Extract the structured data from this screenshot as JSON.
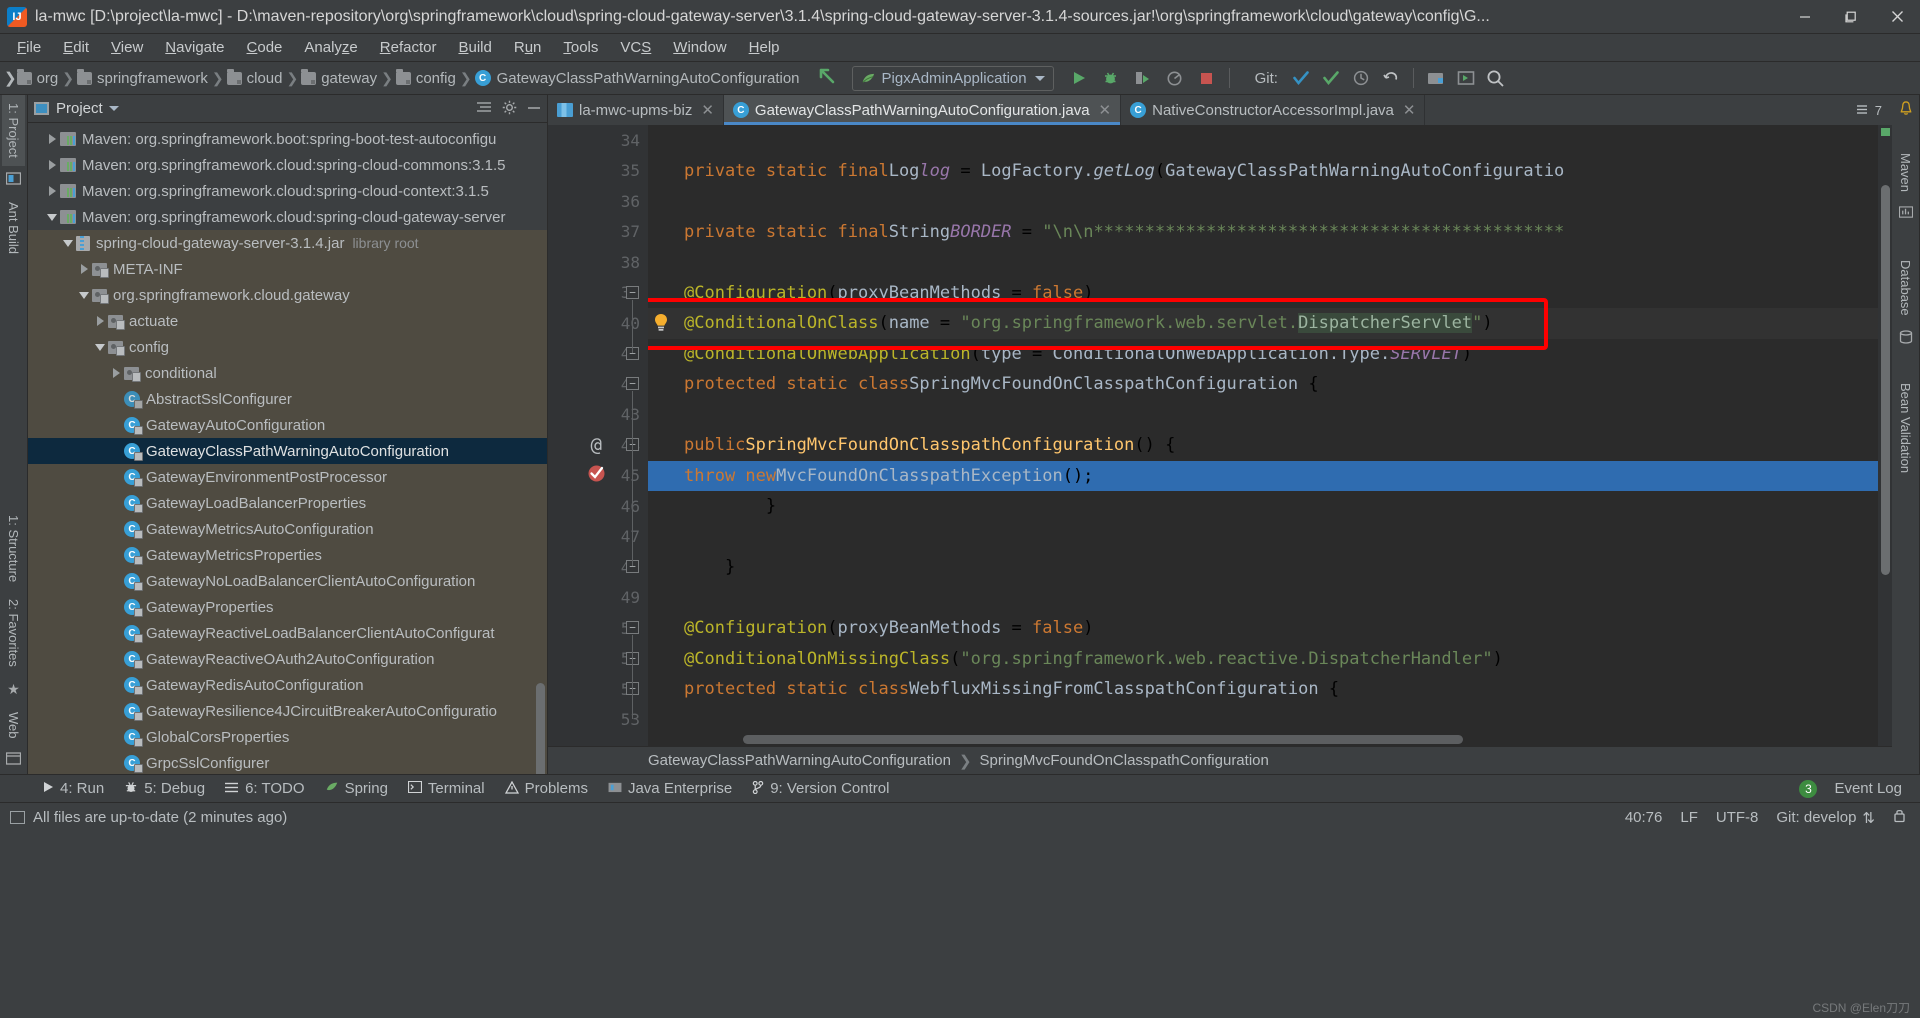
{
  "window": {
    "title": "la-mwc [D:\\project\\la-mwc] - D:\\maven-repository\\org\\springframework\\cloud\\spring-cloud-gateway-server\\3.1.4\\spring-cloud-gateway-server-3.1.4-sources.jar!\\org\\springframework\\cloud\\gateway\\config\\G...",
    "app_icon": "intellij-idea-icon",
    "minimize": "—",
    "maximize": "❐",
    "close": "✕"
  },
  "menubar": [
    {
      "label": "File"
    },
    {
      "label": "Edit"
    },
    {
      "label": "View"
    },
    {
      "label": "Navigate"
    },
    {
      "label": "Code"
    },
    {
      "label": "Analyze"
    },
    {
      "label": "Refactor"
    },
    {
      "label": "Build"
    },
    {
      "label": "Run"
    },
    {
      "label": "Tools"
    },
    {
      "label": "VCS"
    },
    {
      "label": "Window"
    },
    {
      "label": "Help"
    }
  ],
  "navbar": {
    "crumbs": [
      "org",
      "springframework",
      "cloud",
      "gateway",
      "config"
    ],
    "class_crumb": "GatewayClassPathWarningAutoConfiguration",
    "back_arrow_icon": "green-back-arrow-icon",
    "run_config": "PigxAdminApplication",
    "run_config_icon": "spring-leaf-icon",
    "buttons": [
      {
        "name": "run-button",
        "icon": "play-icon"
      },
      {
        "name": "debug-button",
        "icon": "bug-icon"
      },
      {
        "name": "run-with-coverage-button",
        "icon": "coverage-icon"
      },
      {
        "name": "profiler-button",
        "icon": "profiler-icon"
      },
      {
        "name": "stop-button",
        "icon": "stop-square-icon"
      }
    ],
    "git_label": "Git:",
    "git_buttons": [
      {
        "name": "git-update-project-button",
        "icon": "blue-checkmark-icon"
      },
      {
        "name": "git-commit-button",
        "icon": "green-checkmark-icon"
      },
      {
        "name": "git-history-button",
        "icon": "clock-icon"
      },
      {
        "name": "git-rollback-button",
        "icon": "undo-arrow-icon"
      }
    ],
    "right_buttons": [
      {
        "name": "project-structure-button",
        "icon": "project-structure-icon"
      },
      {
        "name": "select-run-target-button",
        "icon": "run-target-icon"
      },
      {
        "name": "search-everywhere-button",
        "icon": "search-icon"
      }
    ]
  },
  "left_strip": [
    {
      "label": "1: Project",
      "active": true
    },
    {
      "label": "Ant Build",
      "active": false
    }
  ],
  "left_strip_lower": [
    {
      "label": "1: Structure"
    },
    {
      "label": "2: Favorites"
    },
    {
      "label": "Web"
    }
  ],
  "right_strip": [
    {
      "label": "Maven"
    },
    {
      "label": "Database"
    },
    {
      "label": "Bean Validation"
    }
  ],
  "project_panel": {
    "title": "Project",
    "title_icon": "project-view-icon",
    "caret_icon": "chevron-down-icon",
    "collapse_all_icon": "collapse-all-icon",
    "settings_icon": "gear-icon",
    "hide_icon": "minimize-icon",
    "tree": [
      {
        "indent": 1,
        "arrow": "right",
        "icon": "maven-library-icon",
        "label": "Maven: org.springframework.boot:spring-boot-test-autoconfigu",
        "style": "normal"
      },
      {
        "indent": 1,
        "arrow": "right",
        "icon": "maven-library-icon",
        "label": "Maven: org.springframework.cloud:spring-cloud-commons:3.1.5",
        "style": "normal"
      },
      {
        "indent": 1,
        "arrow": "right",
        "icon": "maven-library-icon",
        "label": "Maven: org.springframework.cloud:spring-cloud-context:3.1.5",
        "style": "normal"
      },
      {
        "indent": 1,
        "arrow": "down",
        "icon": "maven-library-icon",
        "label": "Maven: org.springframework.cloud:spring-cloud-gateway-server",
        "style": "normal"
      },
      {
        "indent": 2,
        "arrow": "down",
        "icon": "jar-icon",
        "label": "spring-cloud-gateway-server-3.1.4.jar",
        "suffix": "library root",
        "style": "injar"
      },
      {
        "indent": 3,
        "arrow": "right",
        "icon": "package-icon",
        "label": "META-INF",
        "style": "injar"
      },
      {
        "indent": 3,
        "arrow": "down",
        "icon": "package-icon",
        "label": "org.springframework.cloud.gateway",
        "style": "injar"
      },
      {
        "indent": 4,
        "arrow": "right",
        "icon": "package-icon",
        "label": "actuate",
        "style": "injar"
      },
      {
        "indent": 4,
        "arrow": "down",
        "icon": "package-icon",
        "label": "config",
        "style": "injar"
      },
      {
        "indent": 5,
        "arrow": "right",
        "icon": "package-icon",
        "label": "conditional",
        "style": "injar"
      },
      {
        "indent": 5,
        "arrow": "none",
        "icon": "abstract-class-icon",
        "label": "AbstractSslConfigurer",
        "style": "injar"
      },
      {
        "indent": 5,
        "arrow": "none",
        "icon": "class-icon",
        "label": "GatewayAutoConfiguration",
        "style": "injar"
      },
      {
        "indent": 5,
        "arrow": "none",
        "icon": "class-icon",
        "label": "GatewayClassPathWarningAutoConfiguration",
        "style": "selected"
      },
      {
        "indent": 5,
        "arrow": "none",
        "icon": "class-icon",
        "label": "GatewayEnvironmentPostProcessor",
        "style": "injar"
      },
      {
        "indent": 5,
        "arrow": "none",
        "icon": "class-icon",
        "label": "GatewayLoadBalancerProperties",
        "style": "injar"
      },
      {
        "indent": 5,
        "arrow": "none",
        "icon": "class-icon",
        "label": "GatewayMetricsAutoConfiguration",
        "style": "injar"
      },
      {
        "indent": 5,
        "arrow": "none",
        "icon": "class-icon",
        "label": "GatewayMetricsProperties",
        "style": "injar"
      },
      {
        "indent": 5,
        "arrow": "none",
        "icon": "class-icon",
        "label": "GatewayNoLoadBalancerClientAutoConfiguration",
        "style": "injar"
      },
      {
        "indent": 5,
        "arrow": "none",
        "icon": "class-icon",
        "label": "GatewayProperties",
        "style": "injar"
      },
      {
        "indent": 5,
        "arrow": "none",
        "icon": "class-icon",
        "label": "GatewayReactiveLoadBalancerClientAutoConfigurat",
        "style": "injar"
      },
      {
        "indent": 5,
        "arrow": "none",
        "icon": "class-icon",
        "label": "GatewayReactiveOAuth2AutoConfiguration",
        "style": "injar"
      },
      {
        "indent": 5,
        "arrow": "none",
        "icon": "class-icon",
        "label": "GatewayRedisAutoConfiguration",
        "style": "injar"
      },
      {
        "indent": 5,
        "arrow": "none",
        "icon": "class-icon",
        "label": "GatewayResilience4JCircuitBreakerAutoConfiguratio",
        "style": "injar"
      },
      {
        "indent": 5,
        "arrow": "none",
        "icon": "class-icon",
        "label": "GlobalCorsProperties",
        "style": "injar"
      },
      {
        "indent": 5,
        "arrow": "none",
        "icon": "class-icon",
        "label": "GrpcSslConfigurer",
        "style": "injar"
      }
    ]
  },
  "editor": {
    "tabs": [
      {
        "label": "la-mwc-upms-biz",
        "icon": "module-icon",
        "active": false,
        "closable": true
      },
      {
        "label": "GatewayClassPathWarningAutoConfiguration.java",
        "icon": "class-icon",
        "active": true,
        "closable": true
      },
      {
        "label": "NativeConstructorAccessorImpl.java",
        "icon": "class-icon",
        "active": false,
        "closable": true
      }
    ],
    "tab_overflow": "7",
    "tab_overflow_icon": "tab-list-icon",
    "inspection_status_icon": "green-checkmark-icon",
    "first_line_number": 34,
    "lines": [
      {
        "n": 34,
        "text": "",
        "fold": null
      },
      {
        "n": 35,
        "text": "    private static final Log log = LogFactory.getLog(GatewayClassPathWarningAutoConfiguratio",
        "fold": null
      },
      {
        "n": 36,
        "text": "",
        "fold": null
      },
      {
        "n": 37,
        "text": "    private static final String BORDER = \"\\n\\n**********************************************",
        "fold": null
      },
      {
        "n": 38,
        "text": "",
        "fold": null
      },
      {
        "n": 39,
        "text": "    @Configuration(proxyBeanMethods = false)",
        "fold": "minus"
      },
      {
        "n": 40,
        "text": "    @ConditionalOnClass(name = \"org.springframework.web.servlet.DispatcherServlet\")",
        "fold": null,
        "gutter_icon": "lightbulb-icon"
      },
      {
        "n": 41,
        "text": "    @ConditionalOnWebApplication(type = ConditionalOnWebApplication.Type.SERVLET)",
        "fold": "minus"
      },
      {
        "n": 42,
        "text": "    protected static class SpringMvcFoundOnClasspathConfiguration {",
        "fold": "minus"
      },
      {
        "n": 43,
        "text": "",
        "fold": null
      },
      {
        "n": 44,
        "text": "        public SpringMvcFoundOnClasspathConfiguration() {",
        "fold": "minus",
        "gutter_icon": "annotation-at-icon"
      },
      {
        "n": 45,
        "text": "            throw new MvcFoundOnClasspathException();",
        "fold": null,
        "selected": true,
        "gutter_icon": "breakpoint-verified-icon"
      },
      {
        "n": 46,
        "text": "        }",
        "fold": null
      },
      {
        "n": 47,
        "text": "",
        "fold": null
      },
      {
        "n": 48,
        "text": "    }",
        "fold": "minus"
      },
      {
        "n": 49,
        "text": "",
        "fold": null
      },
      {
        "n": 50,
        "text": "    @Configuration(proxyBeanMethods = false)",
        "fold": "minus"
      },
      {
        "n": 51,
        "text": "    @ConditionalOnMissingClass(\"org.springframework.web.reactive.DispatcherHandler\")",
        "fold": "minus"
      },
      {
        "n": 52,
        "text": "    protected static class WebfluxMissingFromClasspathConfiguration {",
        "fold": "minus"
      },
      {
        "n": 53,
        "text": "",
        "fold": null
      }
    ],
    "annotation_box_line": 40,
    "breadcrumb": [
      "GatewayClassPathWarningAutoConfiguration",
      "SpringMvcFoundOnClasspathConfiguration"
    ],
    "highlight_color": "#fe0000",
    "selection_color": "#2f6cb0"
  },
  "toolwindow_bar": [
    {
      "label": "4: Run",
      "icon": "play-icon"
    },
    {
      "label": "5: Debug",
      "icon": "bug-icon"
    },
    {
      "label": "6: TODO",
      "icon": "list-icon"
    },
    {
      "label": "Spring",
      "icon": "spring-leaf-icon"
    },
    {
      "label": "Terminal",
      "icon": "terminal-icon"
    },
    {
      "label": "Problems",
      "icon": "problems-icon"
    },
    {
      "label": "Java Enterprise",
      "icon": "java-enterprise-icon"
    },
    {
      "label": "9: Version Control",
      "icon": "version-control-icon"
    }
  ],
  "toolwindow_right": {
    "event_count": "3",
    "event_log_label": "Event Log"
  },
  "statusbar": {
    "message": "All files are up-to-date (2 minutes ago)",
    "message_icon": "sync-icon",
    "caret_position": "40:76",
    "line_separator": "LF",
    "encoding": "UTF-8",
    "git_branch": "Git: develop",
    "branch_icon": "branch-icon",
    "lock_icon": "lock-icon"
  },
  "watermark": "CSDN @Elen刀刀"
}
